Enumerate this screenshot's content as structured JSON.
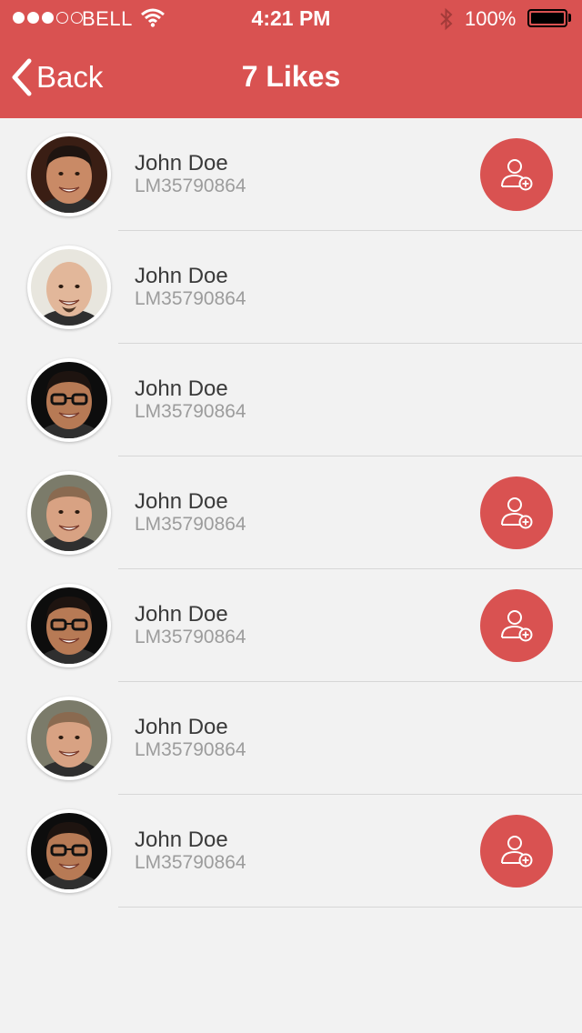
{
  "status_bar": {
    "carrier": "BELL",
    "time": "4:21 PM",
    "battery": "100%"
  },
  "nav": {
    "back_label": "Back",
    "title": "7 Likes"
  },
  "users": [
    {
      "name": "John Doe",
      "id": "LM35790864",
      "follow_button": true,
      "avatar": "young-man-short-dark-hair"
    },
    {
      "name": "John Doe",
      "id": "LM35790864",
      "follow_button": false,
      "avatar": "bald-man-goatee"
    },
    {
      "name": "John Doe",
      "id": "LM35790864",
      "follow_button": false,
      "avatar": "man-with-glasses"
    },
    {
      "name": "John Doe",
      "id": "LM35790864",
      "follow_button": true,
      "avatar": "smiling-man-short-hair"
    },
    {
      "name": "John Doe",
      "id": "LM35790864",
      "follow_button": true,
      "avatar": "man-with-glasses"
    },
    {
      "name": "John Doe",
      "id": "LM35790864",
      "follow_button": false,
      "avatar": "smiling-man-short-hair"
    },
    {
      "name": "John Doe",
      "id": "LM35790864",
      "follow_button": true,
      "avatar": "man-with-glasses"
    }
  ],
  "colors": {
    "accent": "#d95251",
    "background": "#f2f2f2",
    "name_text": "#3a3a3a",
    "id_text": "#9c9c9c",
    "separator": "#d7d7d7"
  }
}
